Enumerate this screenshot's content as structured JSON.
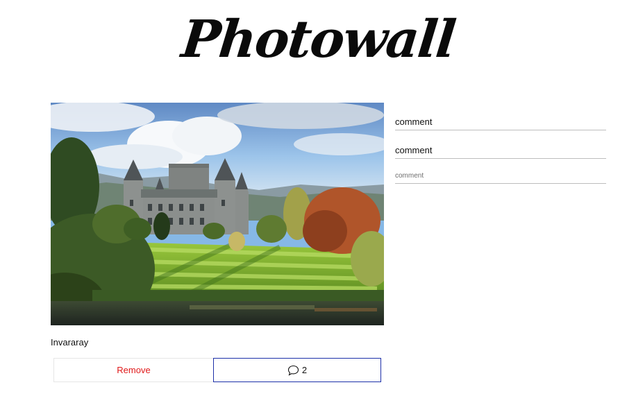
{
  "app": {
    "title": "Photowall"
  },
  "post": {
    "caption": "Invararay",
    "remove_label": "Remove",
    "comment_count": "2",
    "image_icon": "castle-photo"
  },
  "comments": {
    "items": [
      {
        "text": "comment"
      },
      {
        "text": "comment"
      }
    ],
    "input_placeholder": "comment",
    "input_value": ""
  },
  "colors": {
    "remove": "#e0191a",
    "comments_border": "#1c2fa8",
    "divider": "#bdbdbd"
  }
}
